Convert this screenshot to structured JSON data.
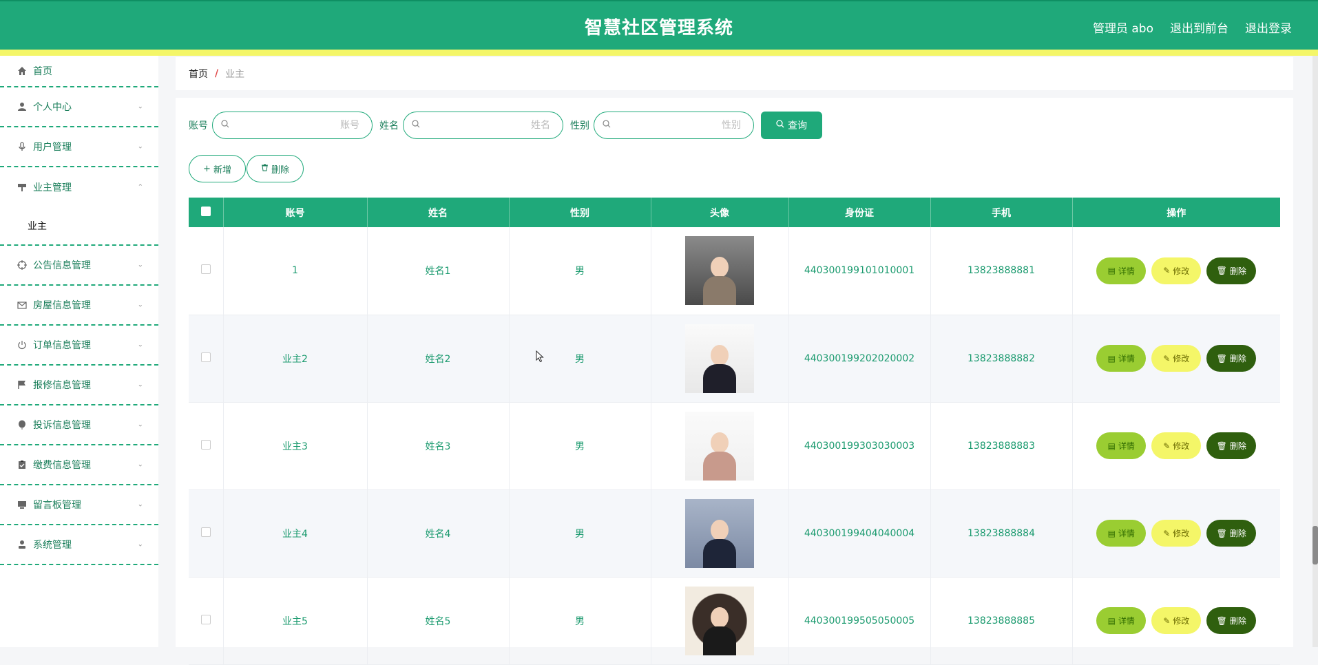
{
  "header": {
    "title": "智慧社区管理系统",
    "admin_label": "管理员 abo",
    "to_frontend": "退出到前台",
    "logout": "退出登录"
  },
  "colors": {
    "brand": "#1fa97a",
    "accent_yellow": "#f4f668",
    "detail": "#9acd32",
    "delete": "#2f5f0e"
  },
  "sidebar": {
    "items": [
      {
        "label": "首页",
        "icon": "home-icon"
      },
      {
        "label": "个人中心",
        "icon": "user-icon"
      },
      {
        "label": "用户管理",
        "icon": "microphone-icon"
      },
      {
        "label": "业主管理",
        "icon": "signpost-icon",
        "expanded": true,
        "children": [
          {
            "label": "业主"
          }
        ]
      },
      {
        "label": "公告信息管理",
        "icon": "target-icon"
      },
      {
        "label": "房屋信息管理",
        "icon": "mail-icon"
      },
      {
        "label": "订单信息管理",
        "icon": "power-icon"
      },
      {
        "label": "报修信息管理",
        "icon": "flag-icon"
      },
      {
        "label": "投诉信息管理",
        "icon": "balloon-icon"
      },
      {
        "label": "缴费信息管理",
        "icon": "clipboard-icon"
      },
      {
        "label": "留言板管理",
        "icon": "monitor-icon"
      },
      {
        "label": "系统管理",
        "icon": "person-icon"
      }
    ]
  },
  "breadcrumb": {
    "home": "首页",
    "separator": "/",
    "current": "业主"
  },
  "search": {
    "account_label": "账号",
    "account_placeholder": "账号",
    "name_label": "姓名",
    "name_placeholder": "姓名",
    "gender_label": "性别",
    "gender_placeholder": "性别",
    "query_button": "查询"
  },
  "actions": {
    "add": "新增",
    "delete": "删除"
  },
  "table": {
    "columns": [
      "账号",
      "姓名",
      "性别",
      "头像",
      "身份证",
      "手机",
      "操作"
    ],
    "ops": {
      "detail": "详情",
      "edit": "修改",
      "delete": "删除"
    },
    "rows": [
      {
        "account": "1",
        "name": "姓名1",
        "gender": "男",
        "id_card": "440300199101010001",
        "phone": "13823888881"
      },
      {
        "account": "业主2",
        "name": "姓名2",
        "gender": "男",
        "id_card": "440300199202020002",
        "phone": "13823888882"
      },
      {
        "account": "业主3",
        "name": "姓名3",
        "gender": "男",
        "id_card": "440300199303030003",
        "phone": "13823888883"
      },
      {
        "account": "业主4",
        "name": "姓名4",
        "gender": "男",
        "id_card": "440300199404040004",
        "phone": "13823888884"
      },
      {
        "account": "业主5",
        "name": "姓名5",
        "gender": "男",
        "id_card": "440300199505050005",
        "phone": "13823888885"
      }
    ]
  }
}
